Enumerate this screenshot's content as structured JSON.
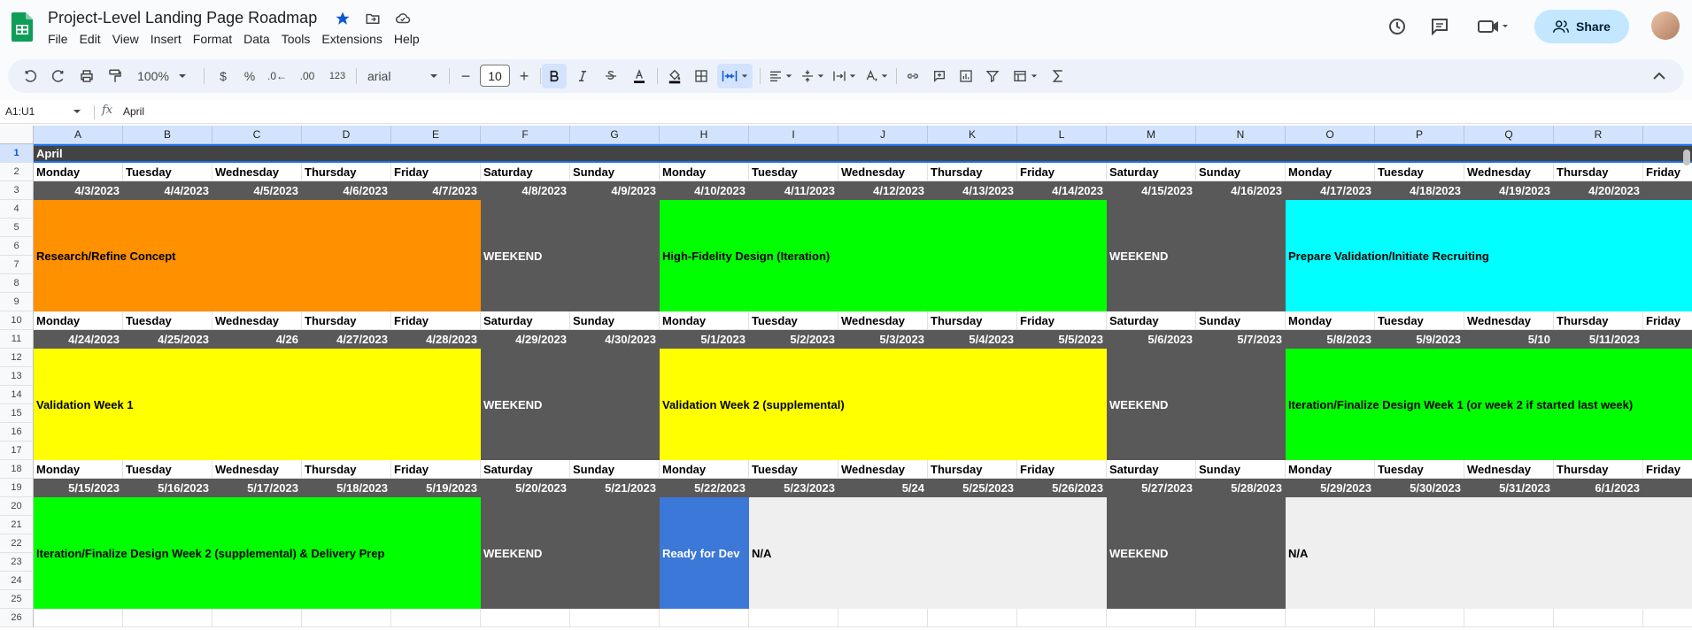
{
  "document": {
    "title": "Project-Level Landing Page Roadmap",
    "menu": [
      "File",
      "Edit",
      "View",
      "Insert",
      "Format",
      "Data",
      "Tools",
      "Extensions",
      "Help"
    ],
    "share_label": "Share"
  },
  "toolbar": {
    "zoom": "100%",
    "currency": "$",
    "percent": "%",
    "dec_less": ".0←",
    "dec_more": ".00",
    "number_format": "123",
    "font": "arial",
    "font_size": "10",
    "minus": "−",
    "plus": "+"
  },
  "formula_bar": {
    "name_box": "A1:U1",
    "fx": "fx",
    "value": "April"
  },
  "columns": [
    "A",
    "B",
    "C",
    "D",
    "E",
    "F",
    "G",
    "H",
    "I",
    "J",
    "K",
    "L",
    "M",
    "N",
    "O",
    "P",
    "Q",
    "R"
  ],
  "rows": [
    "1",
    "2",
    "3",
    "4",
    "5",
    "6",
    "7",
    "8",
    "9",
    "10",
    "11",
    "12",
    "13",
    "14",
    "15",
    "16",
    "17",
    "18",
    "19",
    "20",
    "21",
    "22",
    "23",
    "24",
    "25",
    "26"
  ],
  "month_label": "April",
  "days": [
    "Monday",
    "Tuesday",
    "Wednesday",
    "Thursday",
    "Friday",
    "Saturday",
    "Sunday",
    "Monday",
    "Tuesday",
    "Wednesday",
    "Thursday",
    "Friday",
    "Saturday",
    "Sunday",
    "Monday",
    "Tuesday",
    "Wednesday",
    "Thursday",
    "Friday"
  ],
  "weeks": [
    {
      "dates": [
        "4/3/2023",
        "4/4/2023",
        "4/5/2023",
        "4/6/2023",
        "4/7/2023",
        "4/8/2023",
        "4/9/2023",
        "4/10/2023",
        "4/11/2023",
        "4/12/2023",
        "4/13/2023",
        "4/14/2023",
        "4/15/2023",
        "4/16/2023",
        "4/17/2023",
        "4/18/2023",
        "4/19/2023",
        "4/20/2023",
        "4/"
      ],
      "blocks": [
        {
          "label": "Research/Refine Concept",
          "color": "#ff9000",
          "text_color": "#000000"
        },
        {
          "label": "WEEKEND",
          "color": "#595959",
          "text_color": "#ffffff"
        },
        {
          "label": "High-Fidelity Design (Iteration)",
          "color": "#00ff00",
          "text_color": "#000000"
        },
        {
          "label": "WEEKEND",
          "color": "#595959",
          "text_color": "#ffffff"
        },
        {
          "label": "Prepare Validation/Initiate Recruiting",
          "color": "#00ffff",
          "text_color": "#000000"
        }
      ]
    },
    {
      "dates": [
        "4/24/2023",
        "4/25/2023",
        "4/26",
        "4/27/2023",
        "4/28/2023",
        "4/29/2023",
        "4/30/2023",
        "5/1/2023",
        "5/2/2023",
        "5/3/2023",
        "5/4/2023",
        "5/5/2023",
        "5/6/2023",
        "5/7/2023",
        "5/8/2023",
        "5/9/2023",
        "5/10",
        "5/11/2023",
        "5/"
      ],
      "blocks": [
        {
          "label": "Validation Week 1",
          "color": "#ffff00",
          "text_color": "#000000"
        },
        {
          "label": "WEEKEND",
          "color": "#595959",
          "text_color": "#ffffff"
        },
        {
          "label": "Validation Week 2 (supplemental)",
          "color": "#ffff00",
          "text_color": "#000000"
        },
        {
          "label": "WEEKEND",
          "color": "#595959",
          "text_color": "#ffffff"
        },
        {
          "label": "Iteration/Finalize Design Week 1 (or week 2 if started last week)",
          "color": "#00ff00",
          "text_color": "#000000"
        }
      ]
    },
    {
      "dates": [
        "5/15/2023",
        "5/16/2023",
        "5/17/2023",
        "5/18/2023",
        "5/19/2023",
        "5/20/2023",
        "5/21/2023",
        "5/22/2023",
        "5/23/2023",
        "5/24",
        "5/25/2023",
        "5/26/2023",
        "5/27/2023",
        "5/28/2023",
        "5/29/2023",
        "5/30/2023",
        "5/31/2023",
        "6/1/2023",
        "6"
      ],
      "blocks": [
        {
          "label": "Iteration/Finalize Design Week 2 (supplemental) & Delivery Prep",
          "color": "#00ff00",
          "text_color": "#000000"
        },
        {
          "label": "WEEKEND",
          "color": "#595959",
          "text_color": "#ffffff"
        },
        {
          "label": "Ready for Dev",
          "color": "#3c78d8",
          "text_color": "#ffffff"
        },
        {
          "label": "N/A",
          "color": "#efefef",
          "text_color": "#000000"
        },
        {
          "label": "WEEKEND",
          "color": "#595959",
          "text_color": "#ffffff"
        },
        {
          "label": "N/A",
          "color": "#efefef",
          "text_color": "#000000"
        }
      ]
    }
  ]
}
